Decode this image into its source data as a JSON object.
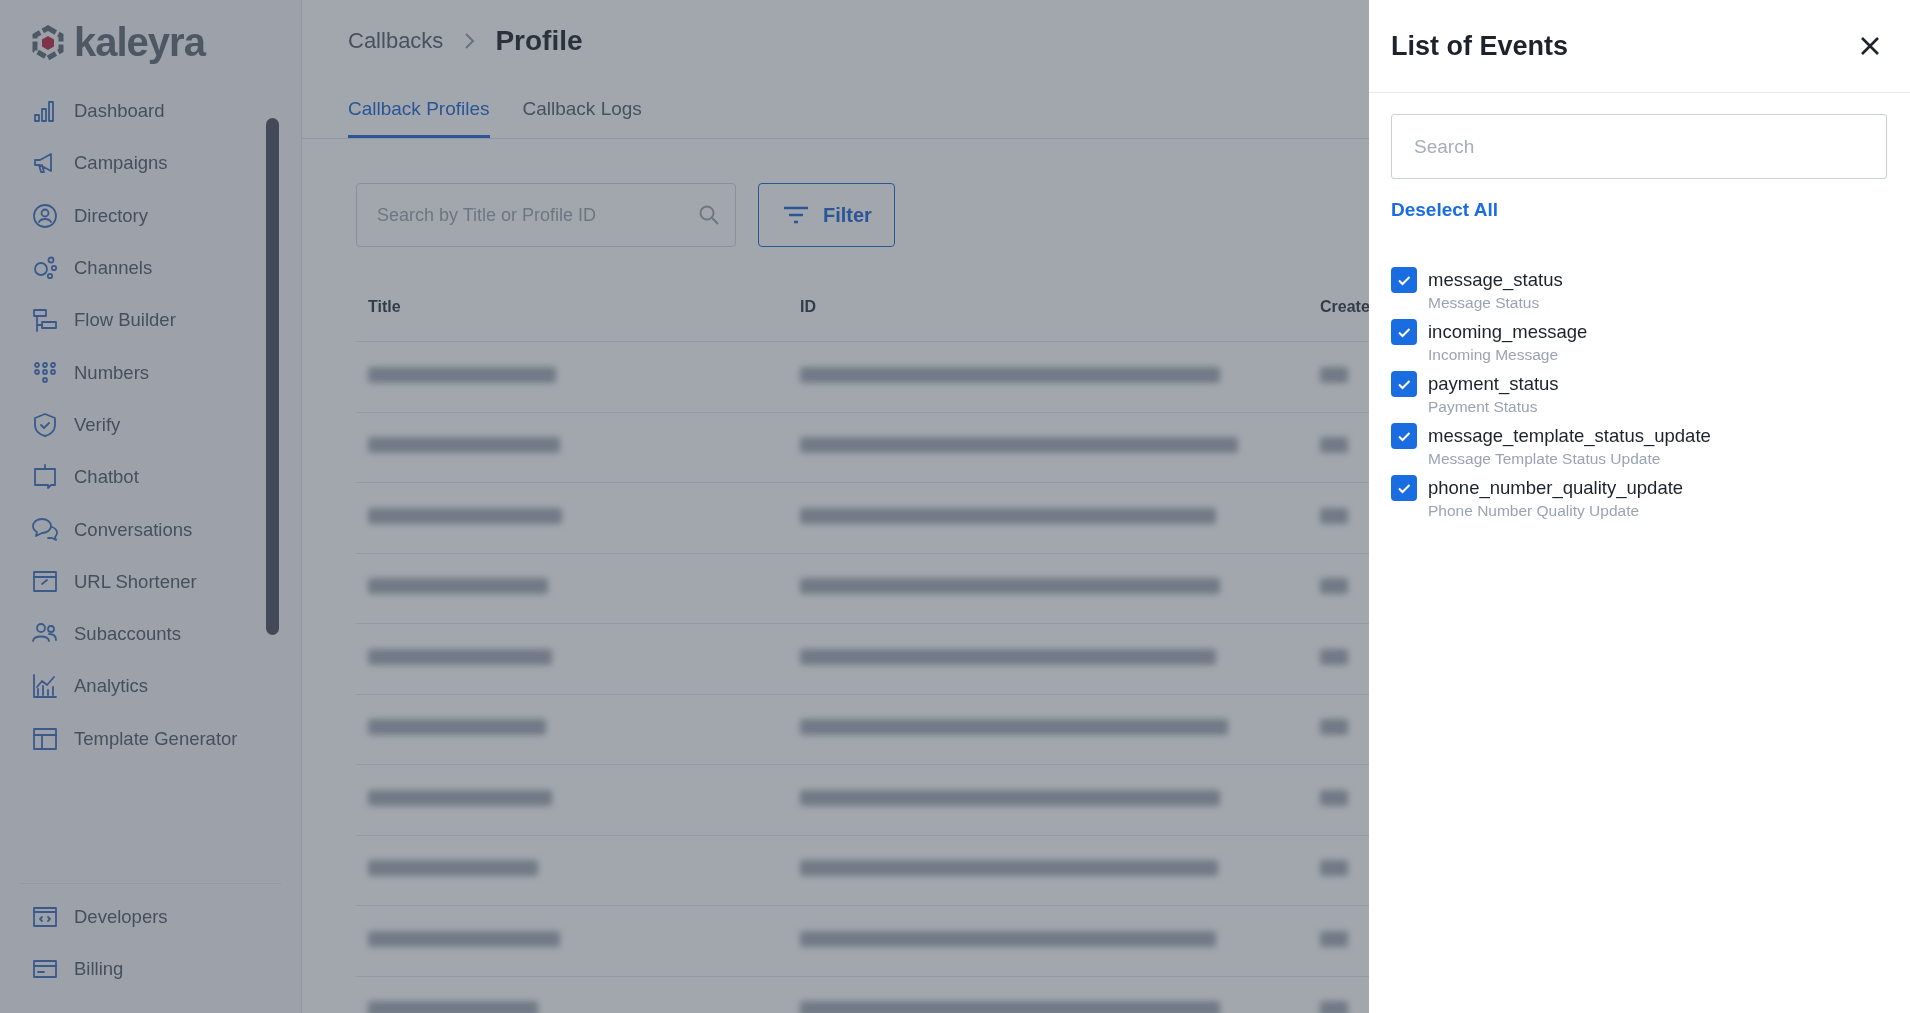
{
  "brand": {
    "name": "kaleyra"
  },
  "sidebar": {
    "items": [
      {
        "label": "Dashboard"
      },
      {
        "label": "Campaigns"
      },
      {
        "label": "Directory"
      },
      {
        "label": "Channels"
      },
      {
        "label": "Flow Builder"
      },
      {
        "label": "Numbers"
      },
      {
        "label": "Verify"
      },
      {
        "label": "Chatbot"
      },
      {
        "label": "Conversations"
      },
      {
        "label": "URL Shortener"
      },
      {
        "label": "Subaccounts"
      },
      {
        "label": "Analytics"
      },
      {
        "label": "Template Generator"
      }
    ],
    "footer_items": [
      {
        "label": "Developers"
      },
      {
        "label": "Billing"
      }
    ]
  },
  "breadcrumb": [
    "Callbacks",
    "Profile"
  ],
  "tabs": [
    {
      "label": "Callback Profiles",
      "selected": true
    },
    {
      "label": "Callback Logs",
      "selected": false
    }
  ],
  "search": {
    "placeholder": "Search by Title or Profile ID"
  },
  "filter_button": "Filter",
  "table": {
    "columns": [
      "Title",
      "ID",
      "Create"
    ]
  },
  "events_panel": {
    "title": "List of Events",
    "search": {
      "placeholder": "Search"
    },
    "deselect_all": "Deselect All",
    "events": [
      {
        "name": "message_status",
        "description": "Message Status",
        "checked": true
      },
      {
        "name": "incoming_message",
        "description": "Incoming Message",
        "checked": true
      },
      {
        "name": "payment_status",
        "description": "Payment Status",
        "checked": true
      },
      {
        "name": "message_template_status_update",
        "description": "Message Template Status Update",
        "checked": true
      },
      {
        "name": "phone_number_quality_update",
        "description": "Phone Number Quality Update",
        "checked": true
      }
    ]
  }
}
